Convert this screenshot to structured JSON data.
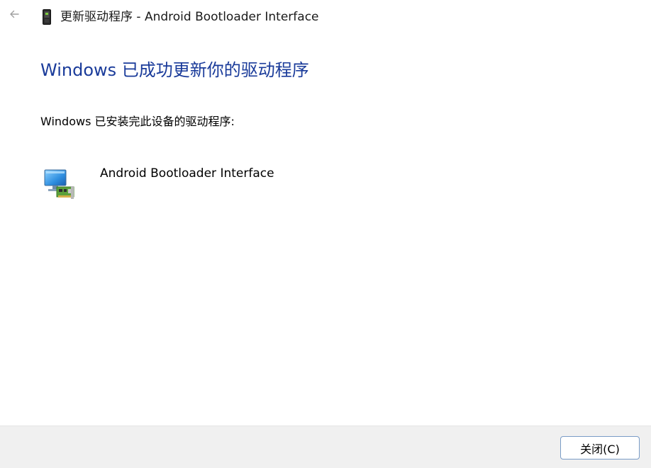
{
  "window": {
    "title": "更新驱动程序 - Android Bootloader Interface"
  },
  "icons": {
    "back": "back-arrow-icon",
    "device_small": "android-device-icon",
    "device_large": "network-adapter-icon"
  },
  "main": {
    "heading": "Windows 已成功更新你的驱动程序",
    "info": "Windows 已安装完此设备的驱动程序:",
    "device_name": "Android Bootloader Interface"
  },
  "footer": {
    "close_label": "关闭(C)"
  },
  "colors": {
    "heading": "#1a3b9a",
    "footer_bg": "#f0f0f0",
    "button_border": "#7a9cc6"
  }
}
